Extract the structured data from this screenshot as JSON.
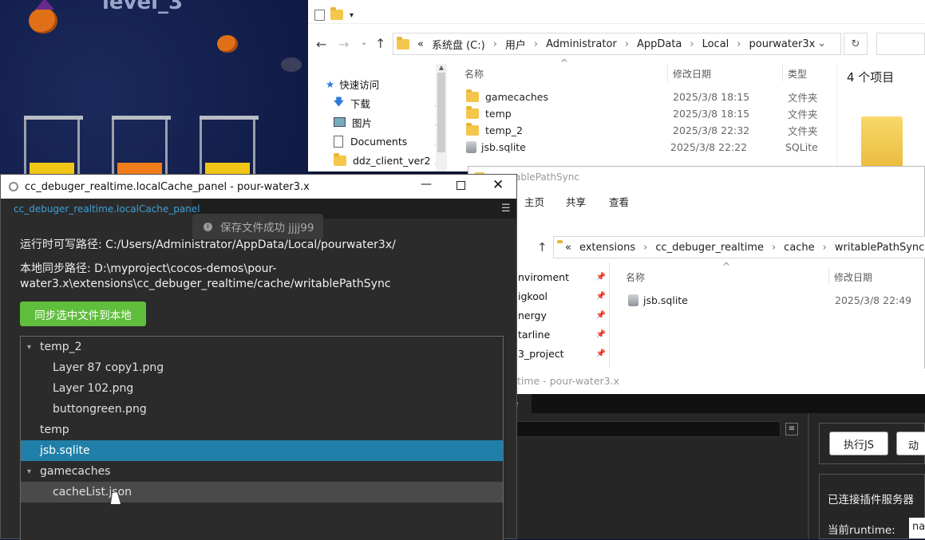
{
  "game": {
    "level_title": "level_3"
  },
  "explorer1": {
    "path": [
      "«",
      "系统盘 (C:)",
      "用户",
      "Administrator",
      "AppData",
      "Local",
      "pourwater3x"
    ],
    "sidebar": [
      {
        "label": "快速访问"
      },
      {
        "label": "下载"
      },
      {
        "label": "图片"
      },
      {
        "label": "Documents"
      },
      {
        "label": "ddz_client_ver2"
      }
    ],
    "columns": {
      "name": "名称",
      "date": "修改日期",
      "type": "类型"
    },
    "files": [
      {
        "name": "gamecaches",
        "date": "2025/3/8 18:15",
        "type": "文件夹",
        "icon": "folder"
      },
      {
        "name": "temp",
        "date": "2025/3/8 18:15",
        "type": "文件夹",
        "icon": "folder"
      },
      {
        "name": "temp_2",
        "date": "2025/3/8 22:32",
        "type": "文件夹",
        "icon": "folder"
      },
      {
        "name": "jsb.sqlite",
        "date": "2025/3/8 22:22",
        "type": "SQLite",
        "icon": "db"
      }
    ],
    "item_count": "4 个项目"
  },
  "explorer2": {
    "title": "ablePathSync",
    "tabs": [
      "主页",
      "共享",
      "查看"
    ],
    "path": [
      "«",
      "extensions",
      "cc_debuger_realtime",
      "cache",
      "writablePathSync"
    ],
    "sidebar": [
      "nviroment",
      "igkool",
      "nergy",
      "tarline",
      "3_project"
    ],
    "columns": {
      "name": "名称",
      "date": "修改日期"
    },
    "files": [
      {
        "name": "jsb.sqlite",
        "date": "2025/3/8 22:49"
      }
    ]
  },
  "dark_window": {
    "title": "time - pour-water3.x",
    "tab": "e",
    "exec_button": "执行JS",
    "partial_button": "动",
    "status": "已连接插件服务器",
    "runtime_label": "当前runtime:",
    "runtime_value": "na"
  },
  "panel": {
    "title": "cc_debuger_realtime.localCache_panel - pour-water3.x",
    "tab": "cc_debuger_realtime.localCache_panel",
    "toast": "保存文件成功 jjjj99",
    "runtime_path_label": "运行时可写路径: C:/Users/Administrator/AppData/Local/pourwater3x/",
    "local_path_label_1": "本地同步路径: D:\\myproject\\cocos-demos\\pour-",
    "local_path_label_2": "water3.x\\extensions\\cc_debuger_realtime/cache/writablePathSync",
    "sync_button": "同步选中文件到本地",
    "tree": [
      {
        "label": "temp_2",
        "level": 0,
        "arrow": "▾"
      },
      {
        "label": "Layer 87 copy1.png",
        "level": 1,
        "arrow": ""
      },
      {
        "label": "Layer 102.png",
        "level": 1,
        "arrow": ""
      },
      {
        "label": "buttongreen.png",
        "level": 1,
        "arrow": ""
      },
      {
        "label": "temp",
        "level": 0,
        "arrow": ""
      },
      {
        "label": "jsb.sqlite",
        "level": 0,
        "arrow": "",
        "selected": true
      },
      {
        "label": "gamecaches",
        "level": 0,
        "arrow": "▾"
      },
      {
        "label": "cacheList.json",
        "level": 1,
        "arrow": "",
        "hover": true
      }
    ]
  },
  "colors": {
    "accent_blue": "#2b8cc4",
    "selected_row": "#1f7fa8",
    "green_button": "#5fbf3c"
  }
}
